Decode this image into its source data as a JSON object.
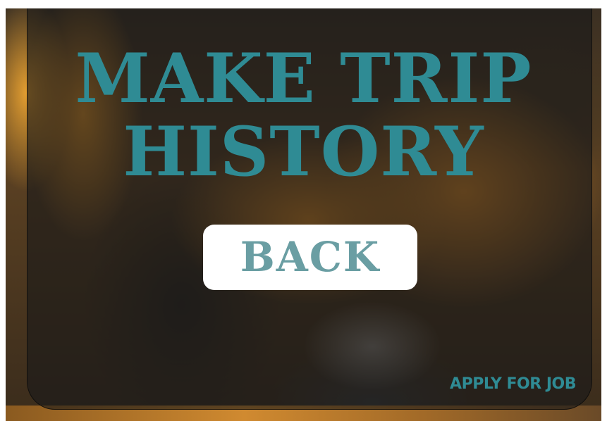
{
  "colors": {
    "accent": "#2f8b94",
    "button_text": "#6a9ea3",
    "button_bg": "#ffffff",
    "card_overlay": "rgba(25,25,25,0.62)"
  },
  "background": {
    "image": "blurred-yellow-taxi-photo"
  },
  "title": {
    "line1": "MAKE TRIP",
    "line2": "HISTORY"
  },
  "back_button": {
    "label": "BACK"
  },
  "apply_link": {
    "label": "APPLY FOR JOB"
  }
}
